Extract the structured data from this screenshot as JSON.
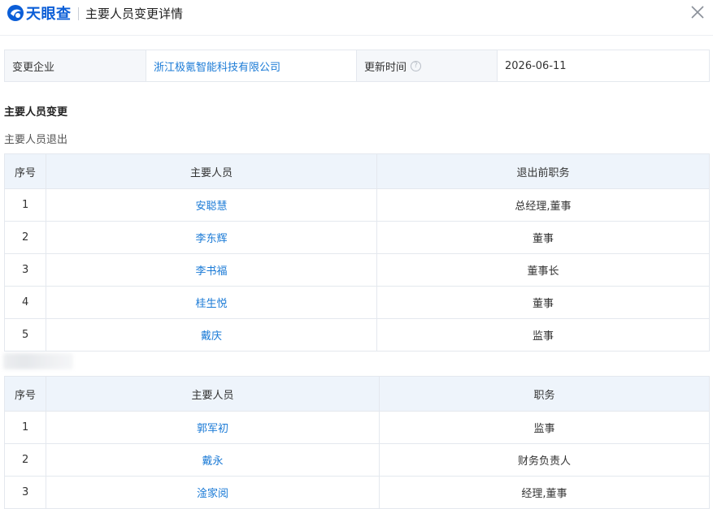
{
  "header": {
    "logo_text": "天眼查",
    "title": "主要人员变更详情"
  },
  "info": {
    "company_label": "变更企业",
    "company_name": "浙江极氪智能科技有限公司",
    "update_label": "更新时间",
    "update_value": "2026-06-11"
  },
  "section": {
    "title": "主要人员变更",
    "exit_title": "主要人员退出"
  },
  "exit_table": {
    "headers": [
      "序号",
      "主要人员",
      "退出前职务"
    ],
    "rows": [
      {
        "idx": "1",
        "name": "安聪慧",
        "role": "总经理,董事"
      },
      {
        "idx": "2",
        "name": "李东辉",
        "role": "董事"
      },
      {
        "idx": "3",
        "name": "李书福",
        "role": "董事长"
      },
      {
        "idx": "4",
        "name": "桂生悦",
        "role": "董事"
      },
      {
        "idx": "5",
        "name": "戴庆",
        "role": "监事"
      }
    ]
  },
  "enter_table": {
    "headers": [
      "序号",
      "主要人员",
      "职务"
    ],
    "rows": [
      {
        "idx": "1",
        "name": "郭军初",
        "role": "监事"
      },
      {
        "idx": "2",
        "name": "戴永",
        "role": "财务负责人"
      },
      {
        "idx": "3",
        "name": "淦家阅",
        "role": "经理,董事"
      }
    ]
  },
  "colors": {
    "brand": "#0b5ed7",
    "link": "#1a7ad6",
    "header_bg": "#eef4fb",
    "border": "#e4e8ee"
  },
  "icons": [
    "tianyancha-logo-icon",
    "close-icon",
    "question-circle-icon"
  ]
}
